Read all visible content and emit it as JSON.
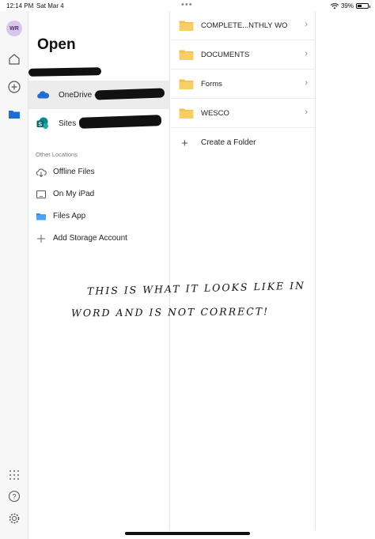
{
  "status_bar": {
    "time": "12:14 PM",
    "date": "Sat Mar 4",
    "battery_text": "39%",
    "battery_level": 0.39,
    "wifi_icon": "wifi-icon"
  },
  "rail": {
    "avatar_initials": "WR",
    "icons": [
      "home-icon",
      "add-icon",
      "folder-icon",
      "apps-icon",
      "help-icon",
      "settings-icon"
    ]
  },
  "open_panel": {
    "title": "Open",
    "locations": [
      {
        "label": "OneDrive -",
        "icon": "onedrive-cloud-icon"
      },
      {
        "label": "Sites",
        "icon": "sharepoint-icon"
      }
    ],
    "other_locations_heading": "Other Locations",
    "other_locations": [
      {
        "label": "Offline Files",
        "icon": "cloud-download-icon"
      },
      {
        "label": "On My iPad",
        "icon": "ipad-icon"
      },
      {
        "label": "Files App",
        "icon": "files-folder-icon"
      },
      {
        "label": "Add Storage Account",
        "icon": "add-icon"
      }
    ]
  },
  "folders": [
    {
      "label": "COMPLETE...NTHLY WO"
    },
    {
      "label": "DOCUMENTS"
    },
    {
      "label": "Forms"
    },
    {
      "label": "WESCO"
    }
  ],
  "create_folder_label": "Create a Folder",
  "handwritten_note": {
    "line1": "THIS IS WHAT IT LOOKS LIKE IN",
    "line2": "WORD AND IS NOT CORRECT!"
  },
  "colors": {
    "folder_yellow": "#f3c14b",
    "onedrive_blue": "#1e6fd0",
    "sharepoint_teal": "#07787b",
    "avatar_bg": "#d9c6ec"
  }
}
